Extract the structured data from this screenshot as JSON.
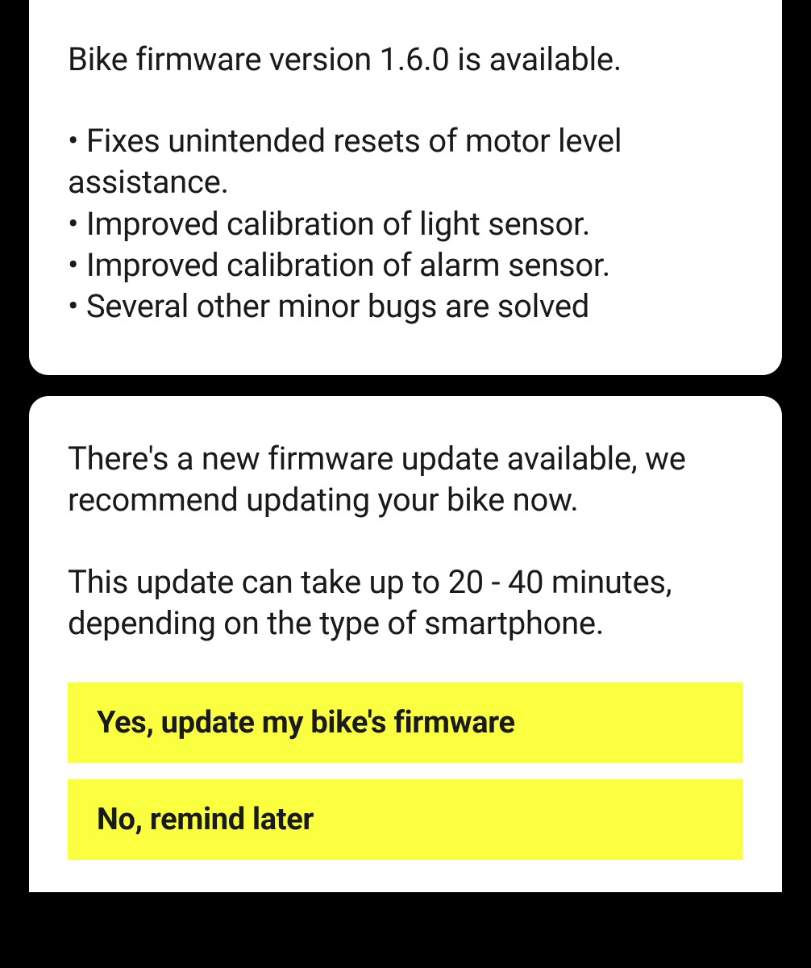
{
  "release_notes": {
    "headline": "Bike firmware version 1.6.0 is available.",
    "bullets": [
      "Fixes unintended resets of motor level assistance.",
      "Improved calibration of light sensor.",
      "Improved calibration of alarm sensor.",
      "Several other minor bugs are solved"
    ]
  },
  "prompt": {
    "paragraph1": "There's a new firmware update available, we recommend updating your bike now.",
    "paragraph2": "This update can take up to 20 - 40 minutes, depending on the type of smartphone."
  },
  "buttons": {
    "confirm": "Yes, update my bike's firmware",
    "dismiss": "No, remind later"
  },
  "colors": {
    "accent": "#faff3f",
    "text": "#1a1a1a",
    "card_bg": "#ffffff",
    "page_bg": "#000000"
  }
}
